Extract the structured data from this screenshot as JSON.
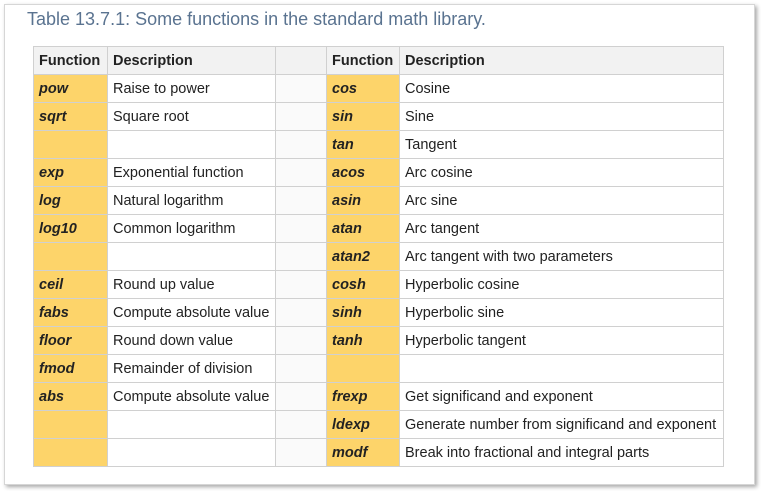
{
  "caption": "Table 13.7.1: Some functions in the standard math library.",
  "headers": {
    "left_function": "Function",
    "left_description": "Description",
    "right_function": "Function",
    "right_description": "Description"
  },
  "rows": [
    {
      "lf": "pow",
      "ld": "Raise to power",
      "rf": "cos",
      "rd": "Cosine"
    },
    {
      "lf": "sqrt",
      "ld": "Square root",
      "rf": "sin",
      "rd": "Sine"
    },
    {
      "lf": "",
      "ld": "",
      "rf": "tan",
      "rd": "Tangent"
    },
    {
      "lf": "exp",
      "ld": "Exponential function",
      "rf": "acos",
      "rd": "Arc cosine"
    },
    {
      "lf": "log",
      "ld": "Natural logarithm",
      "rf": "asin",
      "rd": "Arc sine"
    },
    {
      "lf": "log10",
      "ld": "Common logarithm",
      "rf": "atan",
      "rd": "Arc tangent"
    },
    {
      "lf": "",
      "ld": "",
      "rf": "atan2",
      "rd": "Arc tangent with two parameters"
    },
    {
      "lf": "ceil",
      "ld": "Round up value",
      "rf": "cosh",
      "rd": "Hyperbolic cosine"
    },
    {
      "lf": "fabs",
      "ld": "Compute absolute value",
      "rf": "sinh",
      "rd": "Hyperbolic sine"
    },
    {
      "lf": "floor",
      "ld": "Round down value",
      "rf": "tanh",
      "rd": "Hyperbolic tangent"
    },
    {
      "lf": "fmod",
      "ld": "Remainder of division",
      "rf": "",
      "rd": ""
    },
    {
      "lf": "abs",
      "ld": "Compute absolute value",
      "rf": "frexp",
      "rd": "Get significand and exponent"
    },
    {
      "lf": "",
      "ld": "",
      "rf": "ldexp",
      "rd": "Generate number from significand and exponent"
    },
    {
      "lf": "",
      "ld": "",
      "rf": "modf",
      "rd": "Break into fractional and integral parts"
    }
  ],
  "colors": {
    "function_cell": "#fdd46a",
    "header_bg": "#f2f2f2",
    "caption_text": "#5a7390"
  }
}
